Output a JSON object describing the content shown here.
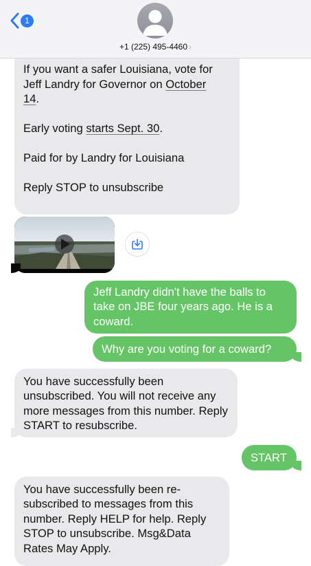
{
  "header": {
    "back_badge": "1",
    "contact_number": "+1 (225) 495-4460",
    "contact_chevron": "›"
  },
  "messages": {
    "m1": {
      "line1": "If you want a safer Louisiana, vote for",
      "line2a": "Jeff Landry for Governor on ",
      "line2b": "October",
      "line3a": "14",
      "line3b": ".",
      "line4a": "Early voting ",
      "line4b": "starts Sept. 30",
      "line4c": ".",
      "line5": "Paid for by Landry for Louisiana",
      "line6": "Reply STOP to unsubscribe"
    },
    "m2": {
      "text": "Jeff Landry didn't have the balls to take on JBE four years ago. He is a coward."
    },
    "m3": {
      "text": "Why are you voting for a coward?"
    },
    "m4": {
      "text": "You have successfully been unsubscribed. You will not receive any more messages from this number. Reply START to resubscribe."
    },
    "m5": {
      "text": "START"
    },
    "m6": {
      "text": "You have successfully been re-subscribed to messages from this number. Reply HELP for help. Reply STOP to unsubscribe. Msg&Data Rates May Apply."
    }
  },
  "colors": {
    "incoming": "#e9e9eb",
    "outgoing": "#65c466",
    "accent": "#2f7bf6"
  }
}
